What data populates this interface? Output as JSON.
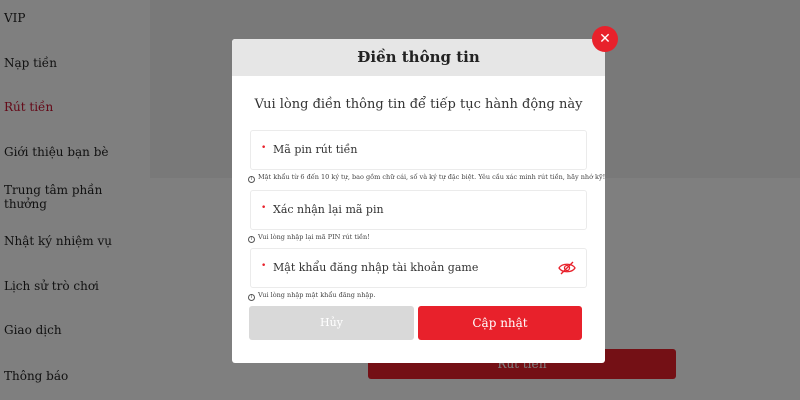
{
  "sidebar": {
    "items": [
      {
        "label": "VIP"
      },
      {
        "label": "Nạp tiền"
      },
      {
        "label": "Rút tiền"
      },
      {
        "label": "Giới thiệu bạn bè"
      },
      {
        "label": "Trung tâm phần thưởng"
      },
      {
        "label": "Nhật ký nhiệm vụ"
      },
      {
        "label": "Lịch sử trò chơi"
      },
      {
        "label": "Giao dịch"
      },
      {
        "label": "Thông báo"
      }
    ],
    "active_index": 2
  },
  "background": {
    "withdraw_button_label": "Rút tiền"
  },
  "modal": {
    "title": "Điền thông tin",
    "subtitle": "Vui lòng điền thông tin để tiếp tục hành động này",
    "close_icon": "close-icon",
    "fields": [
      {
        "label": "Mã pin rút tiền",
        "hint": "Mật khẩu từ 6 đến 10 ký tự, bao gồm chữ cái, số và ký tự đặc biệt. Yêu cầu xác minh rút tiền, hãy nhớ kỹ!"
      },
      {
        "label": "Xác nhận lại mã pin",
        "hint": "Vui lòng nhập lại mã PIN rút tiền!"
      },
      {
        "label": "Mật khẩu đăng nhập tài khoản game",
        "hint": "Vui lòng nhập mật khẩu đăng nhập.",
        "icon": "eye-off-icon"
      }
    ],
    "cancel_label": "Hủy",
    "update_label": "Cập nhật"
  },
  "colors": {
    "accent": "#e8212b",
    "cancel_button": "#d9d9d9",
    "header_bg": "#e6e6e6",
    "active_sidebar": "#c8102e"
  }
}
